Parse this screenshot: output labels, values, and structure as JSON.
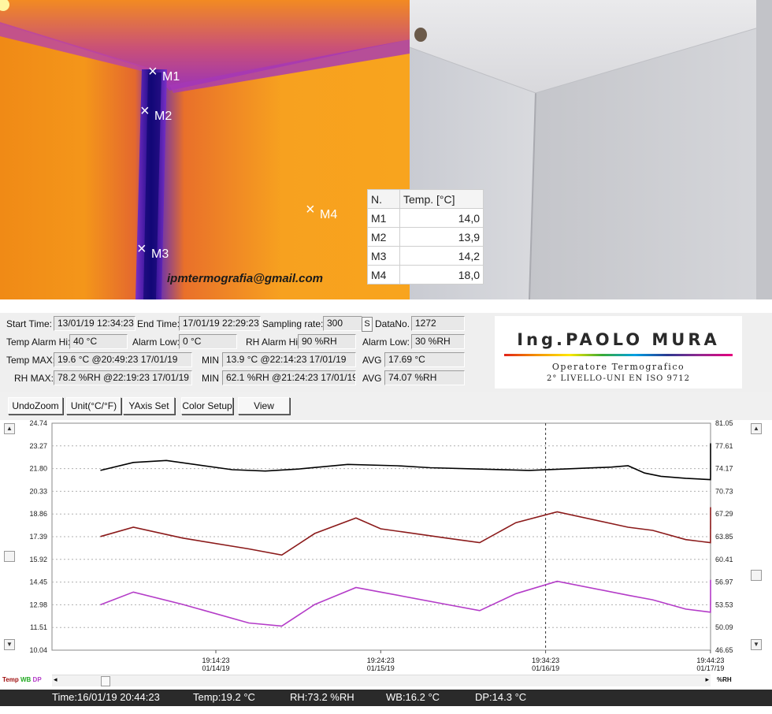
{
  "thermal": {
    "markers": [
      {
        "label": "M1"
      },
      {
        "label": "M2"
      },
      {
        "label": "M3"
      },
      {
        "label": "M4"
      }
    ],
    "email": "ipmtermografia@gmail.com",
    "table": {
      "headers": [
        "N.",
        "Temp. [°C]"
      ],
      "rows": [
        {
          "n": "M1",
          "temp": "14,0"
        },
        {
          "n": "M2",
          "temp": "13,9"
        },
        {
          "n": "M3",
          "temp": "14,2"
        },
        {
          "n": "M4",
          "temp": "18,0"
        }
      ]
    }
  },
  "info": {
    "start_time_label": "Start Time:",
    "start_time": "13/01/19 12:34:23",
    "end_time_label": "End Time:",
    "end_time": "17/01/19 22:29:23",
    "sampling_label": "Sampling rate:",
    "sampling": "300",
    "sampling_unit": "S",
    "datano_label": "DataNo.",
    "datano": "1272",
    "temp_alarm_hi_label": "Temp Alarm Hi:",
    "temp_alarm_hi": "40 °C",
    "alarm_low_label": "Alarm Low:",
    "alarm_low": "0 °C",
    "rh_alarm_hi_label": "RH Alarm Hi:",
    "rh_alarm_hi": "90 %RH",
    "rh_alarm_low_label": "Alarm Low:",
    "rh_alarm_low": "30 %RH",
    "temp_max_label": "Temp MAX:",
    "temp_max": "19.6 °C @20:49:23 17/01/19",
    "temp_min_label": "MIN",
    "temp_min": "13.9 °C @22:14:23 17/01/19",
    "temp_avg_label": "AVG",
    "temp_avg": "17.69 °C",
    "rh_max_label": "RH MAX:",
    "rh_max": "78.2 %RH @22:19:23 17/01/19",
    "rh_min_label": "MIN",
    "rh_min": "62.1 %RH @21:24:23 17/01/19",
    "rh_avg_label": "AVG",
    "rh_avg": "74.07 %RH"
  },
  "logo": {
    "name": "Ing.PAOLO MURA",
    "line1": "Operatore Termografico",
    "line2": "2° LIVELLO-UNI EN ISO 9712",
    "gradient": [
      "#e2231a",
      "#f39200",
      "#ffe800",
      "#3aaa35",
      "#00a0e3",
      "#2b3990",
      "#93278f",
      "#e5007e"
    ]
  },
  "toolbar": {
    "undo_zoom": "UndoZoom",
    "unit": "Unit(°C/°F)",
    "yaxis_set": "YAxis Set",
    "color_setup": "Color Setup",
    "view": "View"
  },
  "legend": {
    "temp": "Temp",
    "wb": "WB",
    "dp": "DP",
    "rh_unit": "%RH"
  },
  "status": {
    "time": "Time:16/01/19 20:44:23",
    "temp": "Temp:19.2 °C",
    "rh": "RH:73.2 %RH",
    "wb": "WB:16.2 °C",
    "dp": "DP:14.3 °C"
  },
  "chart_data": {
    "type": "line",
    "y_left_ticks": [
      "24.74",
      "23.27",
      "21.80",
      "20.33",
      "18.86",
      "17.39",
      "15.92",
      "14.45",
      "12.98",
      "11.51",
      "10.04"
    ],
    "y_right_ticks": [
      "81.05",
      "77.61",
      "74.17",
      "70.73",
      "67.29",
      "63.85",
      "60.41",
      "56.97",
      "53.53",
      "50.09",
      "46.65"
    ],
    "ylim_left": [
      10.04,
      24.74
    ],
    "ylim_right": [
      46.65,
      81.05
    ],
    "x_ticks": [
      {
        "time": "19:14:23",
        "date": "01/14/19"
      },
      {
        "time": "19:24:23",
        "date": "01/15/19"
      },
      {
        "time": "19:34:23",
        "date": "01/16/19"
      },
      {
        "time": "19:44:23",
        "date": "01/17/19"
      }
    ],
    "grid": true,
    "cursor_x_tick": "19:34:23",
    "series": [
      {
        "name": "Temp",
        "axis": "left",
        "color": "#8b1a1a",
        "points": [
          [
            -0.7,
            17.4
          ],
          [
            -0.5,
            18.0
          ],
          [
            -0.2,
            17.3
          ],
          [
            0.2,
            16.6
          ],
          [
            0.4,
            16.2
          ],
          [
            0.6,
            17.6
          ],
          [
            0.85,
            18.6
          ],
          [
            1.0,
            17.9
          ],
          [
            1.4,
            17.3
          ],
          [
            1.6,
            17.0
          ],
          [
            1.82,
            18.3
          ],
          [
            2.07,
            19.0
          ],
          [
            2.5,
            18.0
          ],
          [
            2.65,
            17.8
          ],
          [
            2.85,
            17.2
          ],
          [
            3.0,
            17.0
          ],
          [
            3.18,
            18.6
          ],
          [
            3.3,
            19.3
          ],
          [
            3.6,
            18.6
          ],
          [
            3.85,
            18.3
          ],
          [
            3.98,
            17.9
          ],
          [
            4.08,
            18.8
          ],
          [
            4.2,
            19.2
          ]
        ]
      },
      {
        "name": "RH",
        "axis": "right",
        "color": "#000000",
        "points": [
          [
            -0.7,
            73.9
          ],
          [
            -0.5,
            75.1
          ],
          [
            -0.3,
            75.4
          ],
          [
            0.1,
            74.0
          ],
          [
            0.3,
            73.8
          ],
          [
            0.5,
            74.1
          ],
          [
            0.8,
            74.8
          ],
          [
            1.1,
            74.6
          ],
          [
            1.3,
            74.3
          ],
          [
            1.6,
            74.1
          ],
          [
            1.9,
            73.9
          ],
          [
            2.4,
            74.4
          ],
          [
            2.5,
            74.6
          ],
          [
            2.6,
            73.5
          ],
          [
            2.7,
            73.0
          ],
          [
            2.85,
            72.7
          ],
          [
            3.0,
            72.5
          ],
          [
            3.1,
            73.0
          ],
          [
            3.35,
            73.7
          ],
          [
            3.6,
            74.0
          ],
          [
            3.9,
            74.3
          ],
          [
            3.95,
            78.0
          ],
          [
            4.0,
            74.8
          ],
          [
            4.05,
            76.5
          ],
          [
            4.1,
            75.0
          ],
          [
            4.2,
            73.9
          ]
        ]
      },
      {
        "name": "DP",
        "axis": "left",
        "color": "#b43cc8",
        "points": [
          [
            -0.7,
            12.98
          ],
          [
            -0.5,
            13.8
          ],
          [
            -0.2,
            13.0
          ],
          [
            0.2,
            11.8
          ],
          [
            0.4,
            11.6
          ],
          [
            0.6,
            13.0
          ],
          [
            0.85,
            14.1
          ],
          [
            1.0,
            13.8
          ],
          [
            1.4,
            13.0
          ],
          [
            1.6,
            12.6
          ],
          [
            1.82,
            13.7
          ],
          [
            2.07,
            14.5
          ],
          [
            2.5,
            13.6
          ],
          [
            2.65,
            13.3
          ],
          [
            2.85,
            12.7
          ],
          [
            3.0,
            12.5
          ],
          [
            3.18,
            13.7
          ],
          [
            3.3,
            14.6
          ],
          [
            3.6,
            14.0
          ],
          [
            3.85,
            13.5
          ],
          [
            3.95,
            13.0
          ],
          [
            3.98,
            14.0
          ],
          [
            4.0,
            13.3
          ],
          [
            4.05,
            13.5
          ],
          [
            4.08,
            13.2
          ],
          [
            4.2,
            14.3
          ],
          [
            4.28,
            14.6
          ]
        ]
      }
    ]
  }
}
